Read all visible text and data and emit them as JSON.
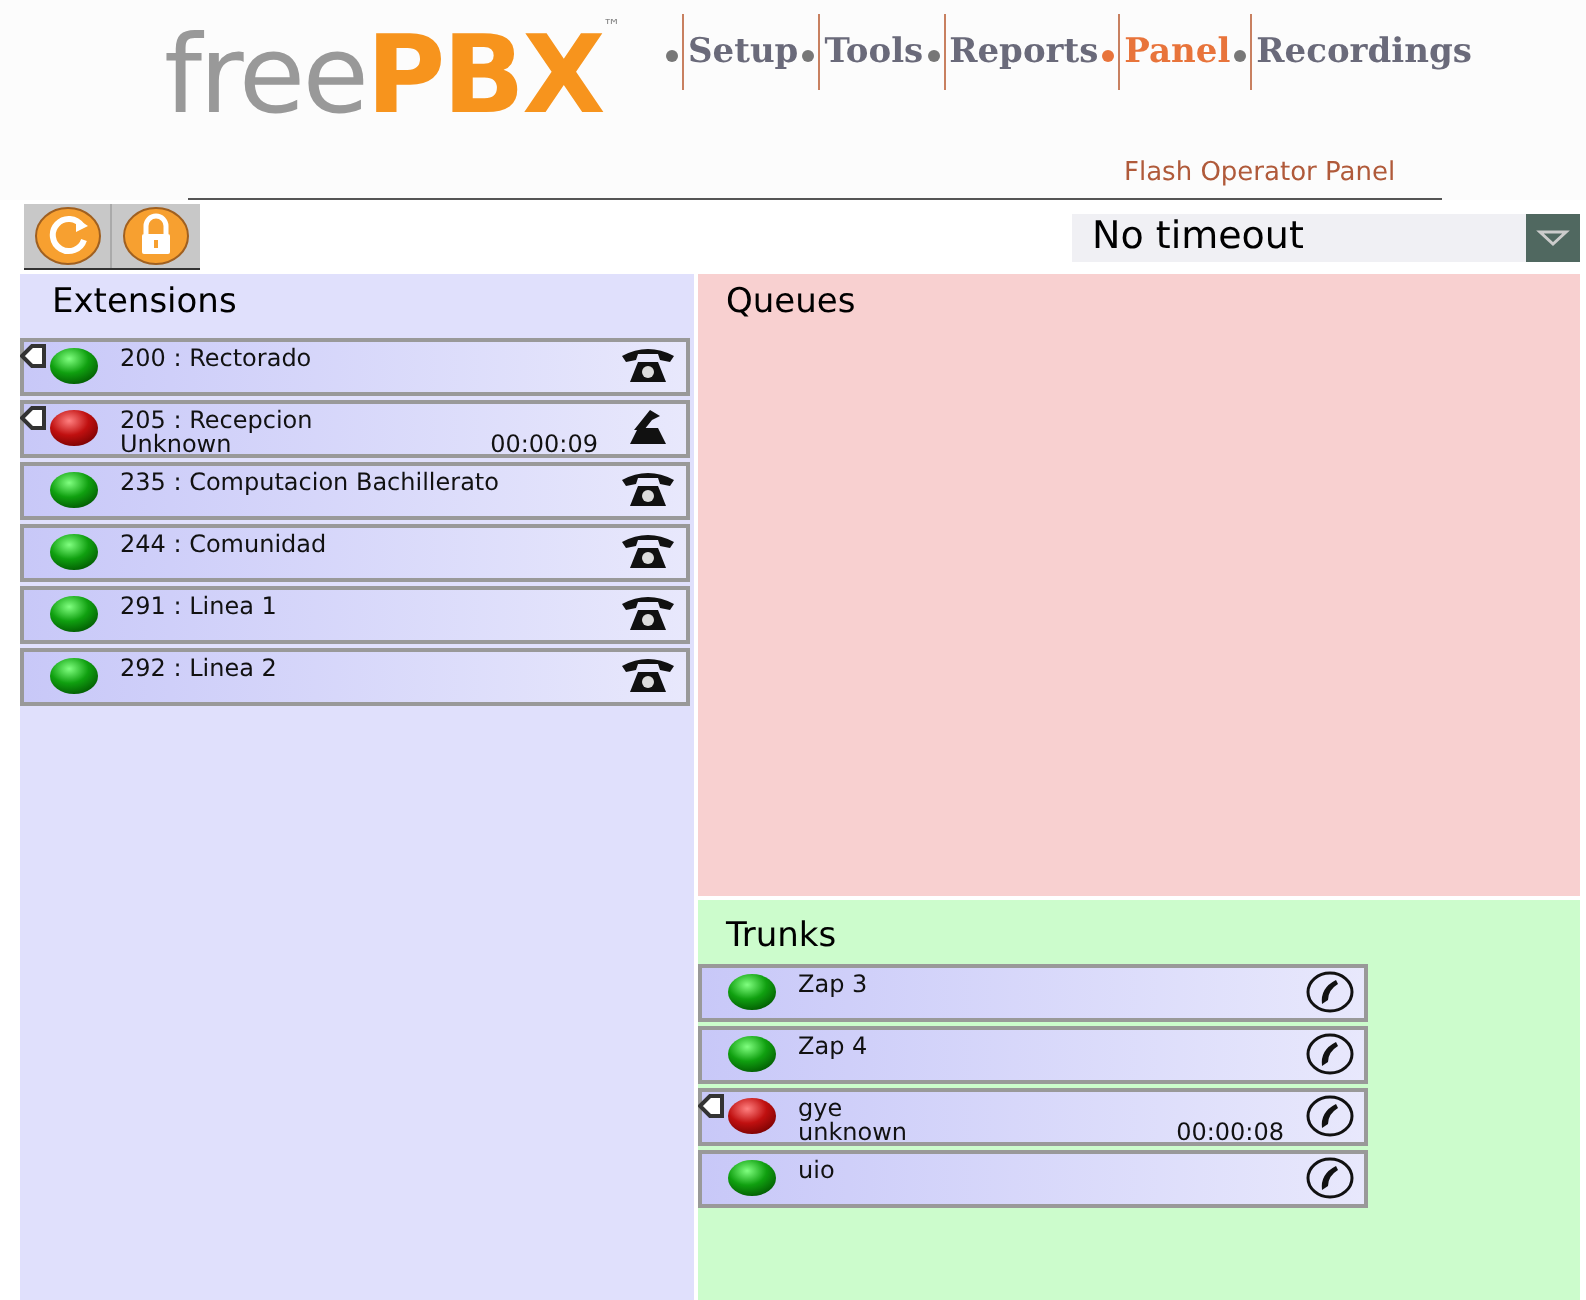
{
  "logo": {
    "part1": "free",
    "part2": "PBX",
    "mark": "™"
  },
  "nav": [
    {
      "label": "Setup",
      "selected": false
    },
    {
      "label": "Tools",
      "selected": false
    },
    {
      "label": "Reports",
      "selected": false
    },
    {
      "label": "Panel",
      "selected": true
    },
    {
      "label": "Recordings",
      "selected": false
    }
  ],
  "subtitle": "Flash Operator Panel",
  "timeout": {
    "value": "No timeout"
  },
  "extensions": {
    "title": "Extensions",
    "items": [
      {
        "label": "200 : Rectorado",
        "busy": false,
        "off_hook": false,
        "flagged": true
      },
      {
        "label": "205 : Recepcion",
        "caller": "Unknown",
        "timer": "00:00:09",
        "busy": true,
        "off_hook": true,
        "flagged": true
      },
      {
        "label": "235 : Computacion Bachillerato",
        "busy": false,
        "off_hook": false,
        "flagged": false
      },
      {
        "label": "244 : Comunidad",
        "busy": false,
        "off_hook": false,
        "flagged": false
      },
      {
        "label": "291 : Linea 1",
        "busy": false,
        "off_hook": false,
        "flagged": false
      },
      {
        "label": "292 : Linea 2",
        "busy": false,
        "off_hook": false,
        "flagged": false
      }
    ]
  },
  "queues": {
    "title": "Queues"
  },
  "trunks": {
    "title": "Trunks",
    "items": [
      {
        "label": "Zap 3",
        "busy": false,
        "flagged": false
      },
      {
        "label": "Zap 4",
        "busy": false,
        "flagged": false
      },
      {
        "label": "gye",
        "caller": "unknown",
        "timer": "00:00:08",
        "busy": true,
        "flagged": true
      },
      {
        "label": "uio",
        "busy": false,
        "flagged": false
      }
    ]
  }
}
